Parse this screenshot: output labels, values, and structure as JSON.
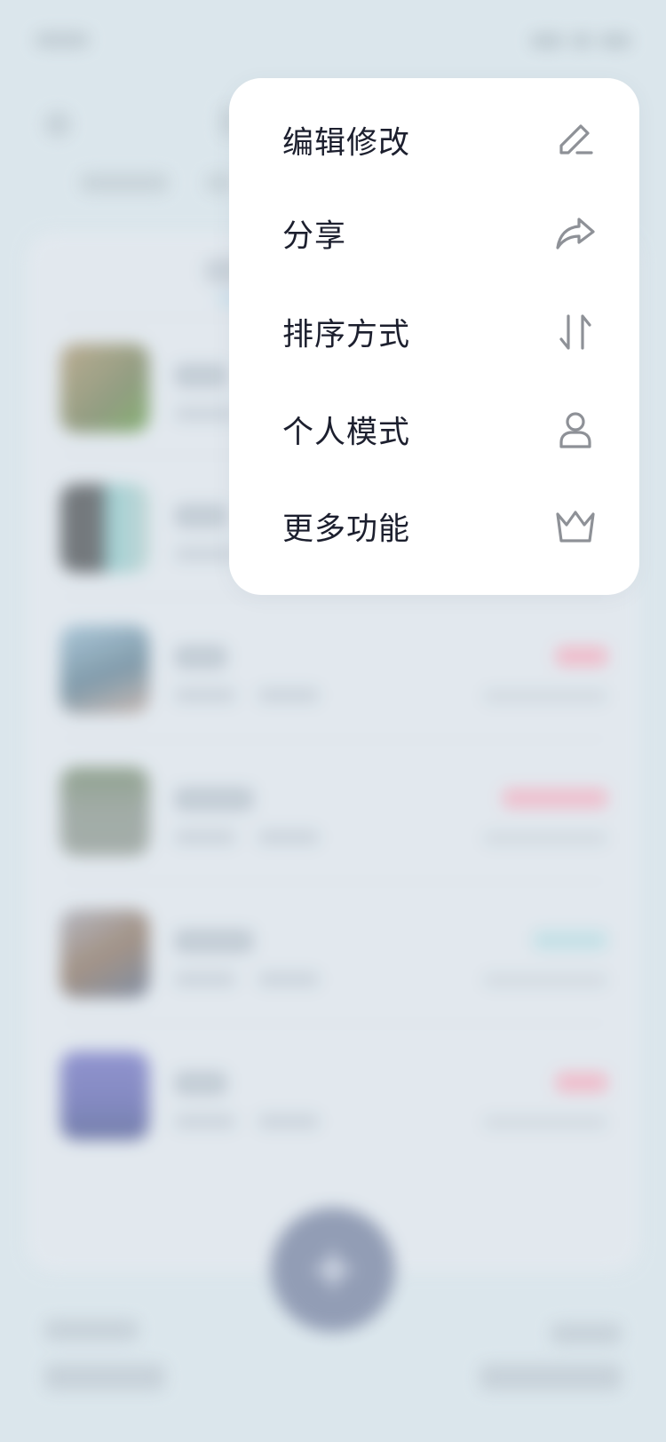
{
  "menu": {
    "items": [
      {
        "label": "编辑修改",
        "icon": "pencil-icon"
      },
      {
        "label": "分享",
        "icon": "share-arrow-icon"
      },
      {
        "label": "排序方式",
        "icon": "sort-arrows-icon"
      },
      {
        "label": "个人模式",
        "icon": "person-icon"
      },
      {
        "label": "更多功能",
        "icon": "crown-icon"
      }
    ]
  },
  "colors": {
    "menu_background": "#ffffff",
    "menu_text": "#1c1f2e",
    "icon_stroke": "#8e9197",
    "backdrop": "#dbe6ec",
    "fab": "#8f9ab3"
  }
}
